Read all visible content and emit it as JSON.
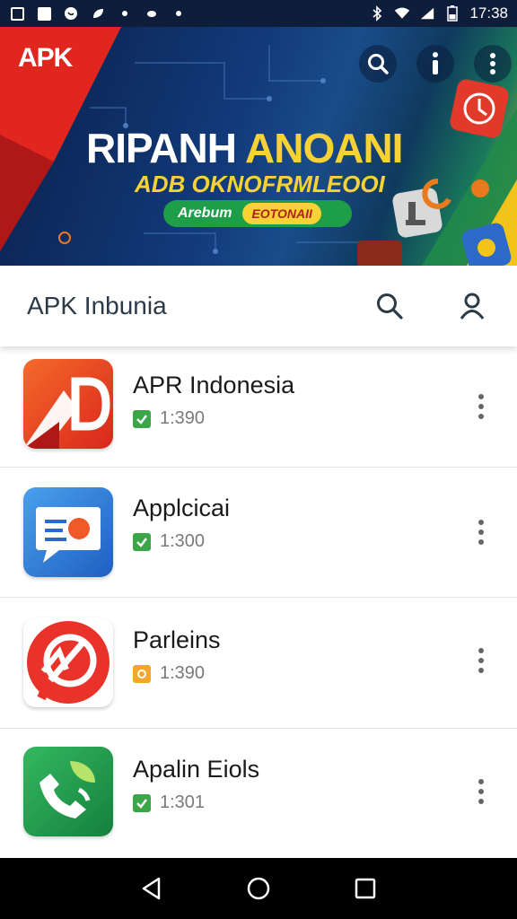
{
  "status_bar": {
    "time": "17:38",
    "left_icons": [
      "gallery-icon",
      "image-icon",
      "whatsapp-icon",
      "leaf-icon",
      "dot-icon",
      "cloud-icon",
      "more-dots-icon"
    ],
    "right_icons": [
      "bluetooth-icon",
      "wifi-icon",
      "signal-icon",
      "battery-icon"
    ]
  },
  "banner": {
    "logo": "APK",
    "title_white": "RIPANH ",
    "title_accent": "ANOANI",
    "subtitle": "ADB OKNOFRMLEOOI",
    "pill_left": "Arebum",
    "pill_right": "EOTONAII",
    "actions": [
      "search-icon",
      "info-icon",
      "more-vertical-icon"
    ]
  },
  "app_bar": {
    "title": "APK Inbunia"
  },
  "apps": [
    {
      "name": "APR Indonesia",
      "meta": "1:390",
      "badge_color": "#3aa648",
      "icon_colors": [
        "#f05a28",
        "#d9261c"
      ]
    },
    {
      "name": "Applcicai",
      "meta": "1:300",
      "badge_color": "#3aa648",
      "icon_colors": [
        "#3a8fe0",
        "#1f5fc0"
      ]
    },
    {
      "name": "Parleins",
      "meta": "1:390",
      "badge_color": "#f2a72a",
      "icon_colors": [
        "#ee3526",
        "#c81e1e"
      ]
    },
    {
      "name": "Apalin Eiols",
      "meta": "1:301",
      "badge_color": "#3aa648",
      "icon_colors": [
        "#2aa855",
        "#15803d"
      ]
    }
  ],
  "nav_bar": {
    "buttons": [
      "back-icon",
      "home-icon",
      "recents-icon"
    ]
  }
}
